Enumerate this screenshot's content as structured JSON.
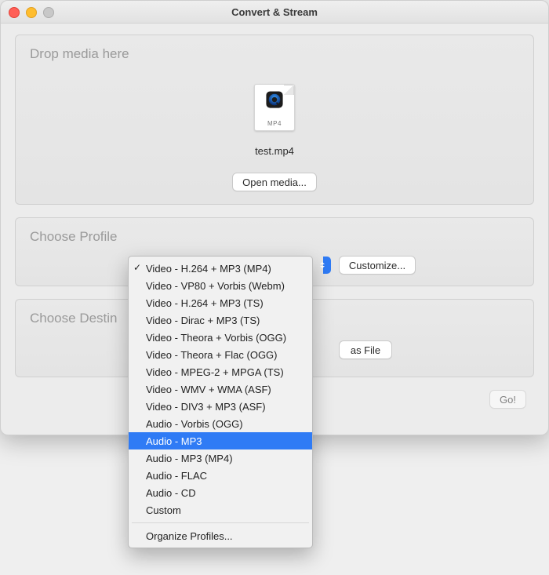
{
  "window": {
    "title": "Convert & Stream"
  },
  "drop": {
    "heading": "Drop media here",
    "file_ext_badge": "MP4",
    "filename": "test.mp4",
    "open_media_label": "Open media..."
  },
  "profile": {
    "heading": "Choose Profile",
    "customize_label": "Customize...",
    "selected": "Video - H.264 + MP3 (MP4)",
    "menu": {
      "items": [
        {
          "label": "Video - H.264 + MP3 (MP4)",
          "checked": true
        },
        {
          "label": "Video - VP80 + Vorbis (Webm)"
        },
        {
          "label": "Video - H.264 + MP3 (TS)"
        },
        {
          "label": "Video - Dirac + MP3 (TS)"
        },
        {
          "label": "Video - Theora + Vorbis (OGG)"
        },
        {
          "label": "Video - Theora + Flac (OGG)"
        },
        {
          "label": "Video - MPEG-2 + MPGA (TS)"
        },
        {
          "label": "Video - WMV + WMA (ASF)"
        },
        {
          "label": "Video - DIV3 + MP3 (ASF)"
        },
        {
          "label": "Audio - Vorbis (OGG)"
        },
        {
          "label": "Audio - MP3",
          "highlighted": true
        },
        {
          "label": "Audio - MP3 (MP4)"
        },
        {
          "label": "Audio - FLAC"
        },
        {
          "label": "Audio - CD"
        },
        {
          "label": "Custom"
        }
      ],
      "footer": "Organize Profiles..."
    }
  },
  "destination": {
    "heading_visible": "Choose Destin",
    "save_as_file_visible": "as File"
  },
  "footer": {
    "go_label": "Go!"
  },
  "icons": {
    "close": "close-icon",
    "minimize": "minimize-icon",
    "zoom": "zoom-icon",
    "quicktime": "quicktime-icon",
    "chevrons": "updown-chevrons-icon"
  },
  "colors": {
    "highlight": "#2f7bf5"
  }
}
